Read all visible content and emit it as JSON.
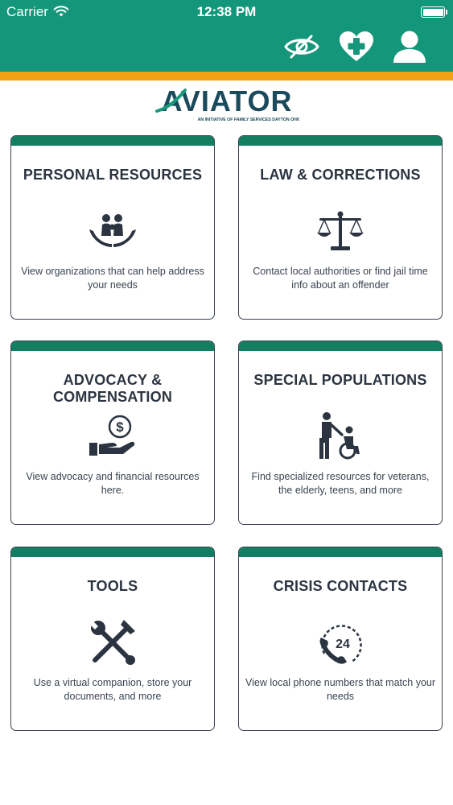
{
  "status_bar": {
    "carrier": "Carrier",
    "time": "12:38 PM",
    "wifi_icon": "wifi-icon",
    "battery_icon": "battery-full-icon"
  },
  "header": {
    "background": "#14967a",
    "accent_bar": "#f0a012",
    "icons": [
      "hide-eye-icon",
      "heart-plus-icon",
      "user-icon"
    ]
  },
  "logo": {
    "text": "AVIATOR",
    "tagline": "AN INITIATIVE OF FAMILY SERVICES DAYTON OHIO"
  },
  "cards": [
    {
      "title": "PERSONAL RESOURCES",
      "description": "View organizations that can help address your needs",
      "icon": "family-hands-icon"
    },
    {
      "title": "LAW & CORRECTIONS",
      "description": "Contact local authorities or find jail time info about an offender",
      "icon": "scales-icon"
    },
    {
      "title": "ADVOCACY & COMPENSATION",
      "description": "View advocacy and financial resources here.",
      "icon": "money-hand-icon"
    },
    {
      "title": "SPECIAL POPULATIONS",
      "description": "Find specialized resources for veterans, the elderly, teens, and more",
      "icon": "wheelchair-assist-icon"
    },
    {
      "title": "TOOLS",
      "description": "Use a virtual companion, store your documents, and more",
      "icon": "tools-icon"
    },
    {
      "title": "CRISIS CONTACTS",
      "description": "View local phone numbers that match your needs",
      "icon": "phone-24-icon"
    }
  ],
  "colors": {
    "card_header": "#137e61",
    "card_border": "#3a4350",
    "text": "#2b3440"
  }
}
